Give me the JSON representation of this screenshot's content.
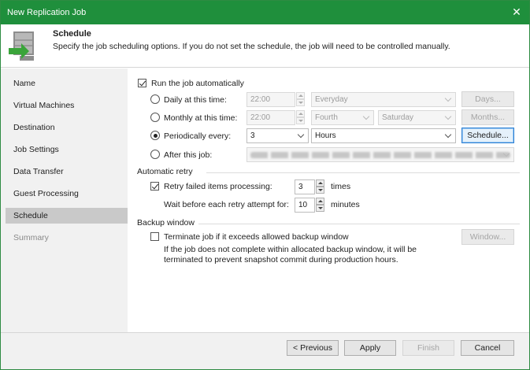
{
  "window": {
    "title": "New Replication Job",
    "close_glyph": "✕"
  },
  "header": {
    "icon": "schedule-wizard-icon",
    "title": "Schedule",
    "description": "Specify the job scheduling options. If you do not set the schedule, the job will need to be controlled manually."
  },
  "sidebar": {
    "items": [
      {
        "label": "Name",
        "state": "normal"
      },
      {
        "label": "Virtual Machines",
        "state": "normal"
      },
      {
        "label": "Destination",
        "state": "normal"
      },
      {
        "label": "Job Settings",
        "state": "normal"
      },
      {
        "label": "Data Transfer",
        "state": "normal"
      },
      {
        "label": "Guest Processing",
        "state": "normal"
      },
      {
        "label": "Schedule",
        "state": "active"
      },
      {
        "label": "Summary",
        "state": "disabled"
      }
    ]
  },
  "schedule": {
    "run_auto_label": "Run the job automatically",
    "run_auto_checked": true,
    "daily": {
      "label": "Daily at this time:",
      "time": "22:00",
      "frequency": "Everyday",
      "button": "Days..."
    },
    "monthly": {
      "label": "Monthly at this time:",
      "time": "22:00",
      "week": "Fourth",
      "day": "Saturday",
      "button": "Months..."
    },
    "periodically": {
      "label": "Periodically every:",
      "value": "3",
      "unit": "Hours",
      "button": "Schedule...",
      "selected": true
    },
    "after": {
      "label": "After this job:"
    }
  },
  "retry": {
    "section_label": "Automatic retry",
    "retry_label": "Retry failed items processing:",
    "retry_checked": true,
    "retry_count": "3",
    "retry_unit": "times",
    "wait_label": "Wait before each retry attempt for:",
    "wait_value": "10",
    "wait_unit": "minutes"
  },
  "backup_window": {
    "section_label": "Backup window",
    "terminate_label": "Terminate job if it exceeds allowed backup window",
    "terminate_checked": false,
    "button": "Window...",
    "note": "If the job does not complete within allocated backup window, it will be terminated to prevent snapshot commit during production hours."
  },
  "footer": {
    "previous": "< Previous",
    "apply": "Apply",
    "finish": "Finish",
    "cancel": "Cancel"
  }
}
